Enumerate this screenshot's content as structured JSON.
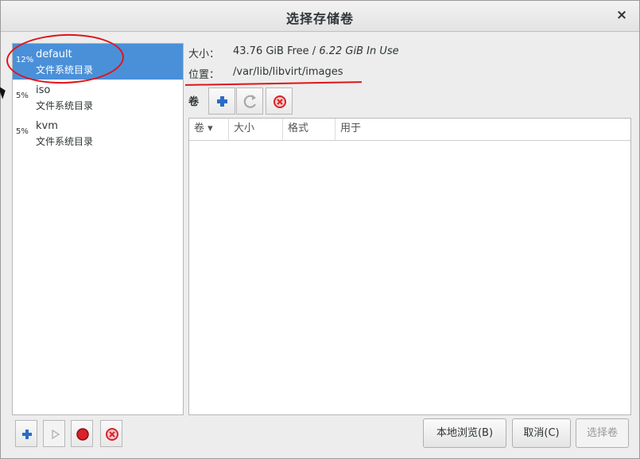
{
  "window": {
    "title": "选择存储卷"
  },
  "pools": [
    {
      "percent": "12%",
      "name": "default",
      "type": "文件系统目录",
      "selected": true
    },
    {
      "percent": "5%",
      "name": "iso",
      "type": "文件系统目录",
      "selected": false
    },
    {
      "percent": "5%",
      "name": "kvm",
      "type": "文件系统目录",
      "selected": false
    }
  ],
  "info": {
    "size_label": "大小：",
    "size_free": "43.76 GiB Free",
    "size_sep": " / ",
    "size_used": "6.22 GiB In Use",
    "location_label": "位置：",
    "location_value": "/var/lib/libvirt/images"
  },
  "volumes": {
    "label": "卷",
    "columns": [
      "卷",
      "大小",
      "格式",
      "用于"
    ],
    "rows": []
  },
  "buttons": {
    "browse_local": "本地浏览(B)",
    "cancel": "取消(C)",
    "choose_volume": "选择卷"
  },
  "icons": {
    "close": "×",
    "sort_indicator": "▾"
  },
  "colors": {
    "selection": "#4a90d9",
    "add_icon": "#2b6cc4",
    "delete_icon": "#d8232a",
    "annotation": "#e0141a"
  }
}
